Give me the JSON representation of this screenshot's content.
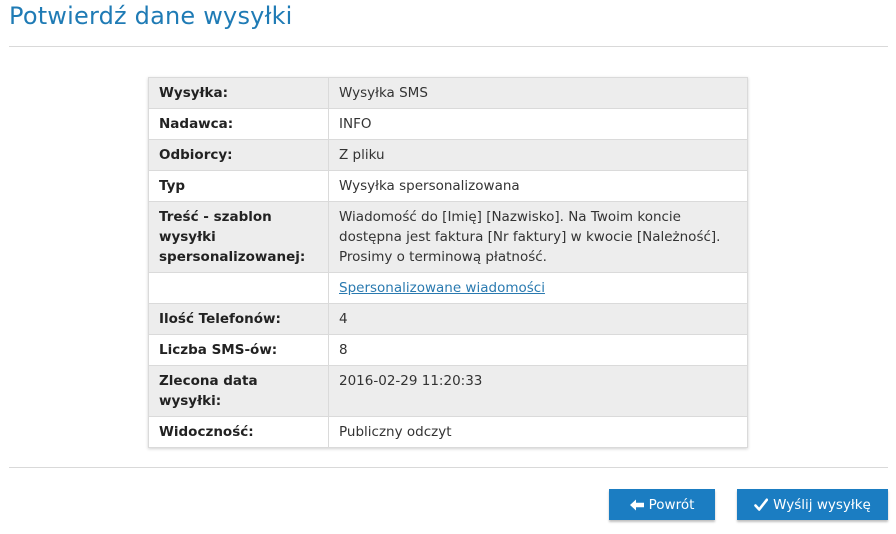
{
  "page": {
    "title": "Potwierdź dane wysyłki"
  },
  "summary": {
    "rows": [
      {
        "label": "Wysyłka:",
        "value": "Wysyłka SMS"
      },
      {
        "label": "Nadawca:",
        "value": "INFO"
      },
      {
        "label": "Odbiorcy:",
        "value": "Z pliku"
      },
      {
        "label": "Typ",
        "value": "Wysyłka spersonalizowana"
      },
      {
        "label": "Treść - szablon wysyłki spersonalizowanej:",
        "value": "Wiadomość do [Imię] [Nazwisko]. Na Twoim koncie dostępna jest faktura [Nr faktury] w kwocie [Należność]. Prosimy o terminową płatność."
      },
      {
        "label": "",
        "link": "Spersonalizowane wiadomości"
      },
      {
        "label": "Ilość Telefonów:",
        "value": "4"
      },
      {
        "label": "Liczba SMS-ów:",
        "value": "8"
      },
      {
        "label": "Zlecona data wysyłki:",
        "value": "2016-02-29 11:20:33"
      },
      {
        "label": "Widoczność:",
        "value": "Publiczny odczyt"
      }
    ]
  },
  "actions": {
    "back_label": "Powrót",
    "back_icon": "arrow-left-icon",
    "send_label": "Wyślij wysyłkę",
    "send_icon": "checkmark-icon"
  },
  "colors": {
    "title": "#1f7bb5",
    "button": "#1b7dc2",
    "link": "#2a7ab0",
    "row_shaded": "#ededed"
  }
}
